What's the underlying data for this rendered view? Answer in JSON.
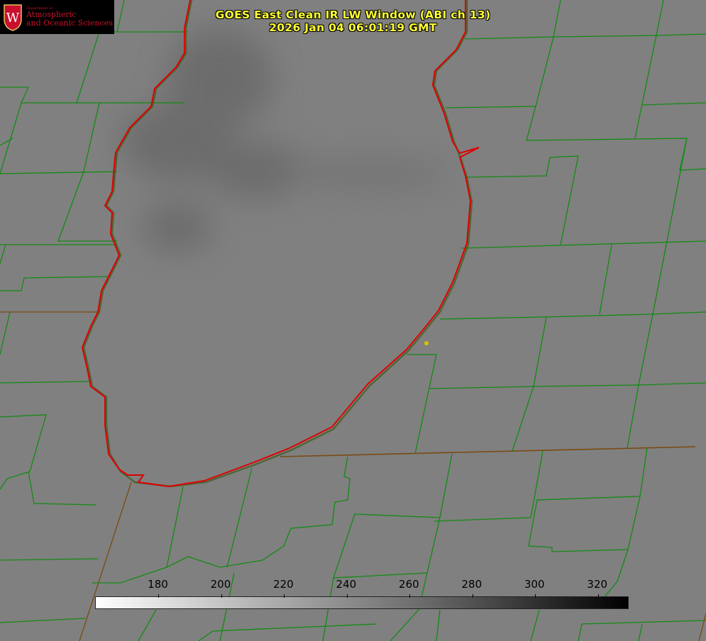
{
  "logo": {
    "line1": "Department of",
    "line2": "Atmospheric",
    "line3": "and Oceanic Sciences",
    "emblem": "W"
  },
  "title": {
    "line1": "GOES East Clean IR LW Window (ABI ch 13)",
    "line2": "2026 Jan 04 06:01:19 GMT"
  },
  "colorbar": {
    "min": 160,
    "max": 330,
    "ticks": [
      180,
      200,
      220,
      240,
      260,
      280,
      300,
      320
    ],
    "labels": [
      "180",
      "200",
      "220",
      "240",
      "260",
      "280",
      "300",
      "320"
    ]
  },
  "colors": {
    "background": "#808080",
    "county_lines": "#138a13",
    "lake_outline": "#e00000",
    "title": "#ffff33",
    "marker": "#d8c400"
  }
}
